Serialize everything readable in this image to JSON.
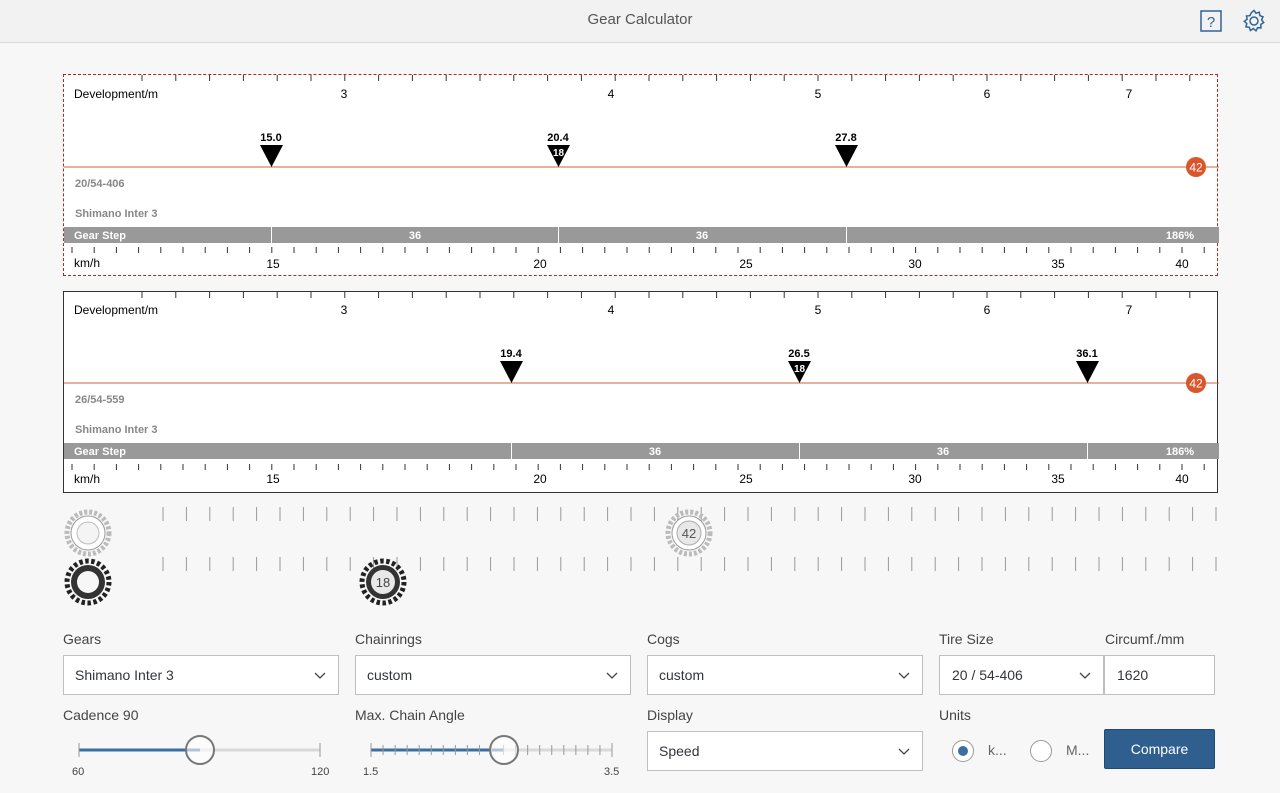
{
  "header": {
    "title": "Gear Calculator",
    "help_icon": "help-icon",
    "settings_icon": "gear-settings-icon"
  },
  "panels": [
    {
      "dev_label": "Development/m",
      "dev_ticks": [
        "3",
        "4",
        "5",
        "6",
        "7"
      ],
      "tire": "20/54-406",
      "hub": "Shimano Inter 3",
      "badge": "42",
      "markers": [
        {
          "speed": "15.0",
          "cog": ""
        },
        {
          "speed": "20.4",
          "cog": "18"
        },
        {
          "speed": "27.8",
          "cog": ""
        }
      ],
      "gear_step_label": "Gear Step",
      "gear_steps": [
        "36",
        "36",
        "186%"
      ],
      "kmh_label": "km/h",
      "kmh_ticks": [
        "15",
        "20",
        "25",
        "30",
        "35",
        "40"
      ]
    },
    {
      "dev_label": "Development/m",
      "dev_ticks": [
        "3",
        "4",
        "5",
        "6",
        "7"
      ],
      "tire": "26/54-559",
      "hub": "Shimano Inter 3",
      "badge": "42",
      "markers": [
        {
          "speed": "19.4",
          "cog": ""
        },
        {
          "speed": "26.5",
          "cog": "18"
        },
        {
          "speed": "36.1",
          "cog": ""
        }
      ],
      "gear_step_label": "Gear Step",
      "gear_steps": [
        "36",
        "36",
        "186%"
      ],
      "kmh_label": "km/h",
      "kmh_ticks": [
        "15",
        "20",
        "25",
        "30",
        "35",
        "40"
      ]
    }
  ],
  "selectors": {
    "chainring_selected": "42",
    "cog_selected": "18"
  },
  "form": {
    "gears_label": "Gears",
    "gears_value": "Shimano Inter 3",
    "chainrings_label": "Chainrings",
    "chainrings_value": "custom",
    "cogs_label": "Cogs",
    "cogs_value": "custom",
    "tire_label": "Tire Size",
    "tire_value": "20 / 54-406",
    "circ_label": "Circumf./mm",
    "circ_value": "1620",
    "cadence_label": "Cadence 90",
    "cadence_min": "60",
    "cadence_max": "120",
    "cadence_value": 90,
    "chain_label": "Max. Chain Angle",
    "chain_min": "1.5",
    "chain_max": "3.5",
    "display_label": "Display",
    "display_value": "Speed",
    "units_label": "Units",
    "unit_km": "k...",
    "unit_mi": "M...",
    "compare_label": "Compare"
  }
}
